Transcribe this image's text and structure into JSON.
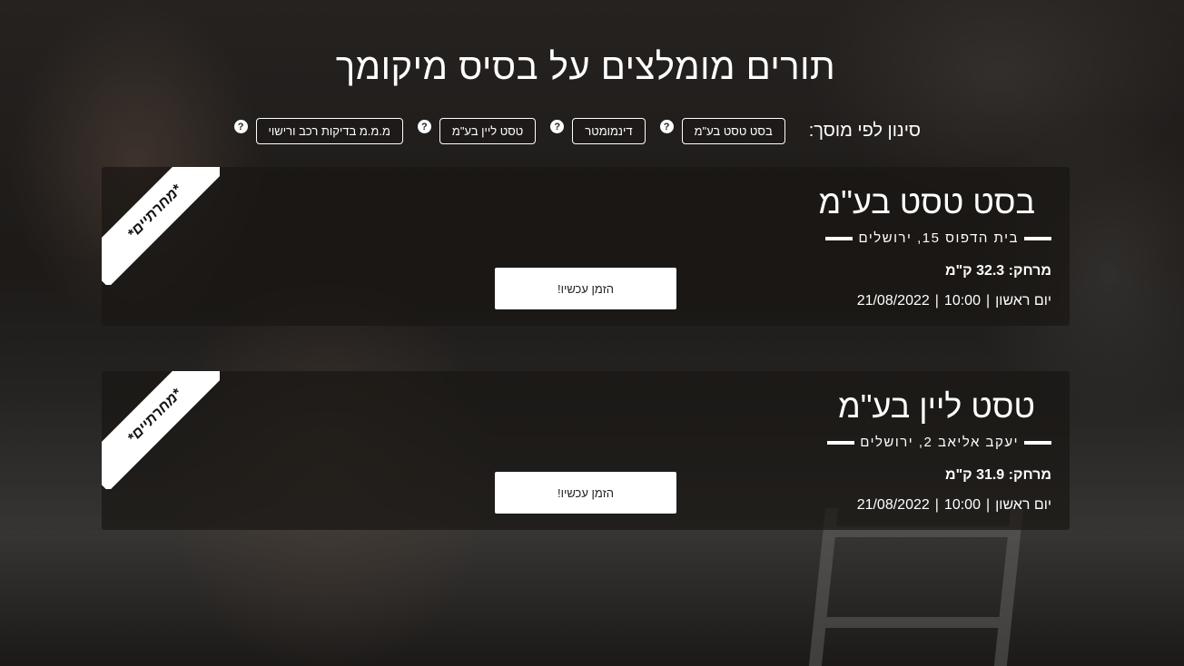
{
  "title": "תורים מומלצים על בסיס מיקומך",
  "filter": {
    "label": "סינון לפי מוסך:",
    "help_glyph": "?",
    "options": [
      {
        "label": "בסט טסט בע\"מ"
      },
      {
        "label": "דינמומטר"
      },
      {
        "label": "טסט ליין בע\"מ"
      },
      {
        "label": "מ.מ.מ בדיקות רכב ורישוי"
      }
    ]
  },
  "appointments": [
    {
      "ribbon": "*מחרתיים*",
      "name": "בסט טסט בע\"מ",
      "address": "בית הדפוס 15, ירושלים",
      "distance": "מרחק: 32.3 ק\"מ",
      "day": "יום ראשון",
      "time": "10:00",
      "date": "21/08/2022",
      "separator": "|",
      "book_label": "הזמן עכשיו!"
    },
    {
      "ribbon": "*מחרתיים*",
      "name": "טסט ליין בע\"מ",
      "address": "יעקב אליאב 2, ירושלים",
      "distance": "מרחק: 31.9 ק\"מ",
      "day": "יום ראשון",
      "time": "10:00",
      "date": "21/08/2022",
      "separator": "|",
      "book_label": "הזמן עכשיו!"
    }
  ]
}
